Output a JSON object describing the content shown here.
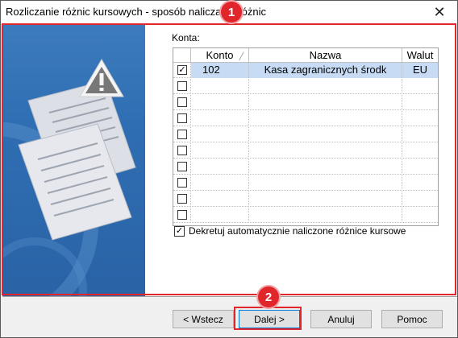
{
  "window": {
    "title": "Rozliczanie różnic kursowych - sposób naliczania różnic",
    "close_icon": "close-icon"
  },
  "content": {
    "konta_label": "Konta:",
    "columns": [
      "Konto",
      "Nazwa",
      "Walut"
    ],
    "rows": [
      {
        "checked": true,
        "konto": "102",
        "nazwa": "Kasa zagranicznych środk",
        "walut": "EU",
        "selected": true
      },
      {
        "checked": false,
        "konto": "",
        "nazwa": "",
        "walut": ""
      },
      {
        "checked": false,
        "konto": "",
        "nazwa": "",
        "walut": ""
      },
      {
        "checked": false,
        "konto": "",
        "nazwa": "",
        "walut": ""
      },
      {
        "checked": false,
        "konto": "",
        "nazwa": "",
        "walut": ""
      },
      {
        "checked": false,
        "konto": "",
        "nazwa": "",
        "walut": ""
      },
      {
        "checked": false,
        "konto": "",
        "nazwa": "",
        "walut": ""
      },
      {
        "checked": false,
        "konto": "",
        "nazwa": "",
        "walut": ""
      },
      {
        "checked": false,
        "konto": "",
        "nazwa": "",
        "walut": ""
      },
      {
        "checked": false,
        "konto": "",
        "nazwa": "",
        "walut": ""
      }
    ],
    "auto_checkbox_label": "Dekretuj automatycznie naliczone różnice kursowe",
    "auto_checked": true
  },
  "buttons": {
    "back": "< Wstecz",
    "next": "Dalej >",
    "cancel": "Anuluj",
    "help": "Pomoc"
  },
  "annotations": {
    "badge1": "1",
    "badge2": "2",
    "color": "#e0252b"
  },
  "colors": {
    "selection": "#c7dcf4",
    "art_panel": "#2f6db2"
  }
}
